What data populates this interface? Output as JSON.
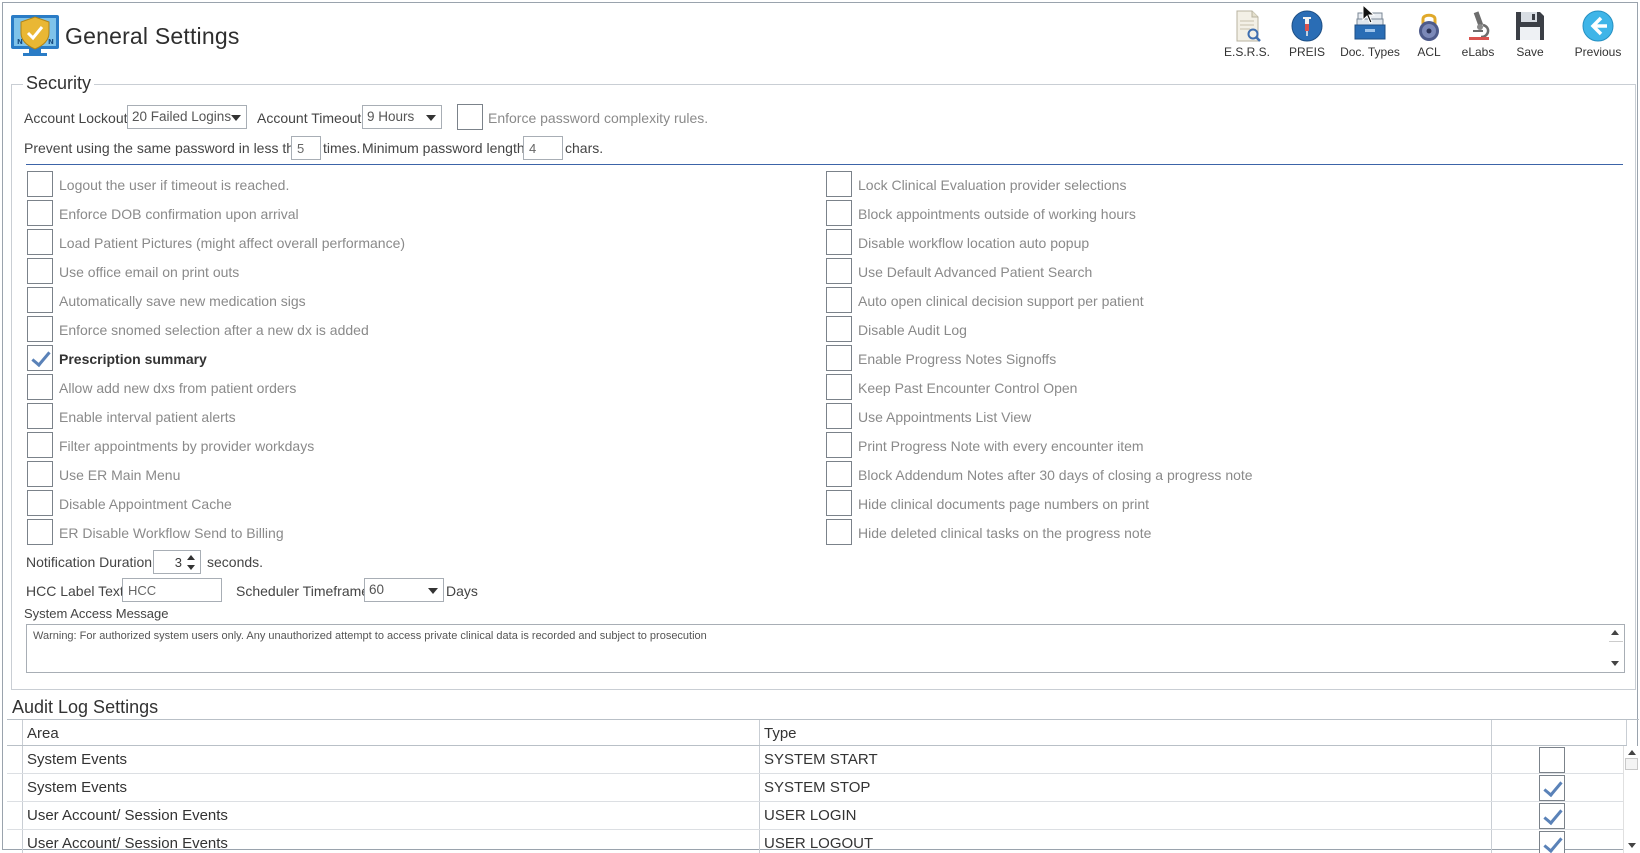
{
  "header": {
    "title": "General Settings",
    "toolbar": [
      {
        "label": "E.S.R.S.",
        "icon": "document-search-icon"
      },
      {
        "label": "PREIS",
        "icon": "syringe-icon"
      },
      {
        "label": "Doc. Types",
        "icon": "file-tray-icon"
      },
      {
        "label": "ACL",
        "icon": "padlock-icon"
      },
      {
        "label": "eLabs",
        "icon": "microscope-icon"
      },
      {
        "label": "Save",
        "icon": "floppy-disk-icon"
      },
      {
        "label": "Previous",
        "icon": "arrow-left-circle-icon"
      }
    ]
  },
  "security": {
    "legend": "Security",
    "account_lockout_label": "Account Lockout",
    "account_lockout_value": "20 Failed Logins",
    "account_timeout_label": "Account Timeout",
    "account_timeout_value": "9 Hours",
    "enforce_complexity_label": "Enforce password complexity rules.",
    "prevent_reuse_label": "Prevent using the same password in less than",
    "prevent_reuse_value": "5",
    "times_label": "times.",
    "min_length_label": "Minimum password length:",
    "min_length_value": "4",
    "chars_label": "chars.",
    "left_options": [
      {
        "label": "Logout the user if timeout is reached.",
        "checked": false
      },
      {
        "label": "Enforce DOB confirmation upon arrival",
        "checked": false
      },
      {
        "label": "Load Patient Pictures (might affect overall performance)",
        "checked": false
      },
      {
        "label": "Use office email on print outs",
        "checked": false
      },
      {
        "label": "Automatically save new medication sigs",
        "checked": false
      },
      {
        "label": "Enforce snomed selection after a new dx is added",
        "checked": false
      },
      {
        "label": "Prescription summary",
        "checked": true
      },
      {
        "label": "Allow add new dxs from patient orders",
        "checked": false
      },
      {
        "label": "Enable interval patient alerts",
        "checked": false
      },
      {
        "label": "Filter appointments by provider workdays",
        "checked": false
      },
      {
        "label": "Use ER Main Menu",
        "checked": false
      },
      {
        "label": "Disable Appointment Cache",
        "checked": false
      },
      {
        "label": "ER Disable Workflow Send to Billing",
        "checked": false
      }
    ],
    "right_options": [
      {
        "label": "Lock Clinical Evaluation provider selections",
        "checked": false
      },
      {
        "label": "Block appointments outside of working hours",
        "checked": false
      },
      {
        "label": "Disable workflow location auto popup",
        "checked": false
      },
      {
        "label": "Use Default Advanced Patient Search",
        "checked": false
      },
      {
        "label": "Auto open clinical decision support per patient",
        "checked": false
      },
      {
        "label": "Disable Audit Log",
        "checked": false
      },
      {
        "label": "Enable Progress Notes Signoffs",
        "checked": false
      },
      {
        "label": "Keep Past Encounter Control Open",
        "checked": false
      },
      {
        "label": "Use Appointments List View",
        "checked": false
      },
      {
        "label": "Print Progress Note with every encounter item",
        "checked": false
      },
      {
        "label": "Block Addendum Notes after 30 days of closing a progress note",
        "checked": false
      },
      {
        "label": "Hide clinical documents page numbers on print",
        "checked": false
      },
      {
        "label": "Hide deleted clinical tasks on the progress note",
        "checked": false
      }
    ],
    "notification_duration_label": "Notification Duration",
    "notification_duration_value": "3",
    "seconds_label": "seconds.",
    "hcc_label": "HCC Label Text:",
    "hcc_value": "HCC",
    "scheduler_label": "Scheduler Timeframe",
    "scheduler_value": "60",
    "days_label": "Days",
    "system_access_label": "System Access Message",
    "system_access_message": "Warning: For authorized system users only. Any unauthorized attempt to access private clinical data is recorded and subject to prosecution"
  },
  "audit": {
    "title": "Audit Log Settings",
    "columns": [
      "Area",
      "Type"
    ],
    "rows": [
      {
        "area": "System Events",
        "type": "SYSTEM START",
        "checked": false
      },
      {
        "area": "System Events",
        "type": "SYSTEM STOP",
        "checked": true
      },
      {
        "area": "User Account/ Session Events",
        "type": "USER LOGIN",
        "checked": true
      },
      {
        "area": "User Account/ Session Events",
        "type": "USER LOGOUT",
        "checked": true
      }
    ]
  },
  "colors": {
    "accent_blue": "#3c64a8",
    "check_blue": "#5a82b8",
    "toolbar_blue": "#2a6db5"
  }
}
